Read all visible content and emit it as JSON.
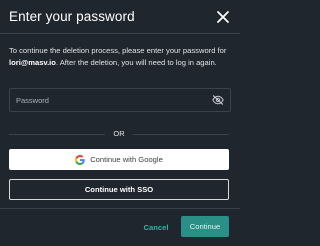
{
  "dialog": {
    "title": "Enter your password",
    "close_icon": "close-icon",
    "description_prefix": "To continue the deletion process, please enter your password for ",
    "email": "lori@masv.io",
    "description_suffix": ". After the deletion, you will need to log in again."
  },
  "password": {
    "placeholder": "Password",
    "value": "",
    "icon": "eye-off-icon"
  },
  "divider": {
    "or_label": "OR"
  },
  "google_button": {
    "label": "Continue with Google",
    "icon": "google-icon"
  },
  "sso_button": {
    "label": "Continue with SSO"
  },
  "footer": {
    "cancel_label": "Cancel",
    "continue_label": "Continue"
  },
  "colors": {
    "background": "#1f262e",
    "accent": "#2a8f86",
    "accent_text": "#2fb5a6",
    "border": "#3a434d"
  }
}
